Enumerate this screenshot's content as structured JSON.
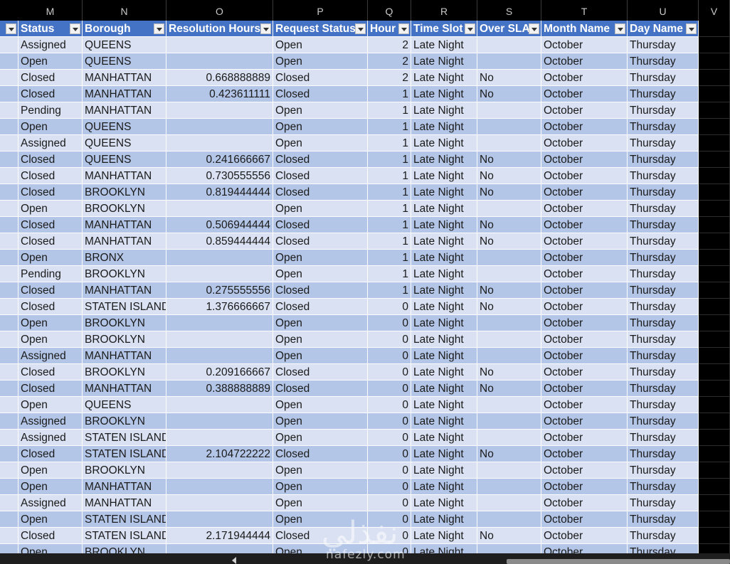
{
  "columns": [
    "M",
    "N",
    "O",
    "P",
    "Q",
    "R",
    "S",
    "T",
    "U",
    "V"
  ],
  "headers": [
    "Status",
    "Borough",
    "Resolution Hours",
    "Request Status",
    "Hour",
    "Time Slot",
    "Over SLA",
    "Month Name",
    "Day Name"
  ],
  "rows": [
    [
      "Assigned",
      "QUEENS",
      "",
      "Open",
      "2",
      "Late Night",
      "",
      "October",
      "Thursday"
    ],
    [
      "Open",
      "QUEENS",
      "",
      "Open",
      "2",
      "Late Night",
      "",
      "October",
      "Thursday"
    ],
    [
      "Closed",
      "MANHATTAN",
      "0.668888889",
      "Closed",
      "2",
      "Late Night",
      "No",
      "October",
      "Thursday"
    ],
    [
      "Closed",
      "MANHATTAN",
      "0.423611111",
      "Closed",
      "1",
      "Late Night",
      "No",
      "October",
      "Thursday"
    ],
    [
      "Pending",
      "MANHATTAN",
      "",
      "Open",
      "1",
      "Late Night",
      "",
      "October",
      "Thursday"
    ],
    [
      "Open",
      "QUEENS",
      "",
      "Open",
      "1",
      "Late Night",
      "",
      "October",
      "Thursday"
    ],
    [
      "Assigned",
      "QUEENS",
      "",
      "Open",
      "1",
      "Late Night",
      "",
      "October",
      "Thursday"
    ],
    [
      "Closed",
      "QUEENS",
      "0.241666667",
      "Closed",
      "1",
      "Late Night",
      "No",
      "October",
      "Thursday"
    ],
    [
      "Closed",
      "MANHATTAN",
      "0.730555556",
      "Closed",
      "1",
      "Late Night",
      "No",
      "October",
      "Thursday"
    ],
    [
      "Closed",
      "BROOKLYN",
      "0.819444444",
      "Closed",
      "1",
      "Late Night",
      "No",
      "October",
      "Thursday"
    ],
    [
      "Open",
      "BROOKLYN",
      "",
      "Open",
      "1",
      "Late Night",
      "",
      "October",
      "Thursday"
    ],
    [
      "Closed",
      "MANHATTAN",
      "0.506944444",
      "Closed",
      "1",
      "Late Night",
      "No",
      "October",
      "Thursday"
    ],
    [
      "Closed",
      "MANHATTAN",
      "0.859444444",
      "Closed",
      "1",
      "Late Night",
      "No",
      "October",
      "Thursday"
    ],
    [
      "Open",
      "BRONX",
      "",
      "Open",
      "1",
      "Late Night",
      "",
      "October",
      "Thursday"
    ],
    [
      "Pending",
      "BROOKLYN",
      "",
      "Open",
      "1",
      "Late Night",
      "",
      "October",
      "Thursday"
    ],
    [
      "Closed",
      "MANHATTAN",
      "0.275555556",
      "Closed",
      "1",
      "Late Night",
      "No",
      "October",
      "Thursday"
    ],
    [
      "Closed",
      "STATEN ISLAND",
      "1.376666667",
      "Closed",
      "0",
      "Late Night",
      "No",
      "October",
      "Thursday"
    ],
    [
      "Open",
      "BROOKLYN",
      "",
      "Open",
      "0",
      "Late Night",
      "",
      "October",
      "Thursday"
    ],
    [
      "Open",
      "BROOKLYN",
      "",
      "Open",
      "0",
      "Late Night",
      "",
      "October",
      "Thursday"
    ],
    [
      "Assigned",
      "MANHATTAN",
      "",
      "Open",
      "0",
      "Late Night",
      "",
      "October",
      "Thursday"
    ],
    [
      "Closed",
      "BROOKLYN",
      "0.209166667",
      "Closed",
      "0",
      "Late Night",
      "No",
      "October",
      "Thursday"
    ],
    [
      "Closed",
      "MANHATTAN",
      "0.388888889",
      "Closed",
      "0",
      "Late Night",
      "No",
      "October",
      "Thursday"
    ],
    [
      "Open",
      "QUEENS",
      "",
      "Open",
      "0",
      "Late Night",
      "",
      "October",
      "Thursday"
    ],
    [
      "Assigned",
      "BROOKLYN",
      "",
      "Open",
      "0",
      "Late Night",
      "",
      "October",
      "Thursday"
    ],
    [
      "Assigned",
      "STATEN ISLAND",
      "",
      "Open",
      "0",
      "Late Night",
      "",
      "October",
      "Thursday"
    ],
    [
      "Closed",
      "STATEN ISLAND",
      "2.104722222",
      "Closed",
      "0",
      "Late Night",
      "No",
      "October",
      "Thursday"
    ],
    [
      "Open",
      "BROOKLYN",
      "",
      "Open",
      "0",
      "Late Night",
      "",
      "October",
      "Thursday"
    ],
    [
      "Open",
      "MANHATTAN",
      "",
      "Open",
      "0",
      "Late Night",
      "",
      "October",
      "Thursday"
    ],
    [
      "Assigned",
      "MANHATTAN",
      "",
      "Open",
      "0",
      "Late Night",
      "",
      "October",
      "Thursday"
    ],
    [
      "Open",
      "STATEN ISLAND",
      "",
      "Open",
      "0",
      "Late Night",
      "",
      "October",
      "Thursday"
    ],
    [
      "Closed",
      "STATEN ISLAND",
      "2.171944444",
      "Closed",
      "0",
      "Late Night",
      "No",
      "October",
      "Thursday"
    ],
    [
      "Open",
      "BROOKLYN",
      "",
      "Open",
      "0",
      "Late Night",
      "",
      "October",
      "Thursday"
    ]
  ],
  "watermark": {
    "arabic": "نفذلي",
    "latin": "nafezly.com"
  },
  "colors": {
    "header_bg": "#4472c4",
    "band_dark": "#b4c6e7",
    "band_light": "#d9e1f2",
    "background": "#000000"
  }
}
